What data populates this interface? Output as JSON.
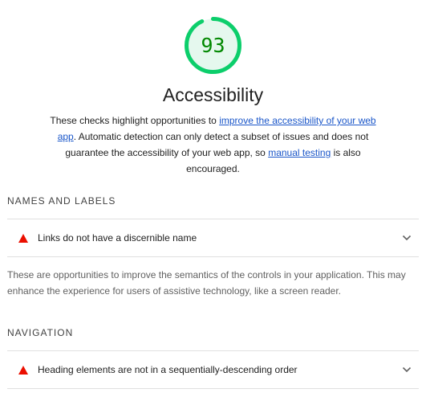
{
  "score": {
    "value": "93",
    "fraction": 0.93,
    "color": "#0cce6b",
    "track_color": "#e5f8ee",
    "text_color": "#008800"
  },
  "category": {
    "title": "Accessibility",
    "description": {
      "part1": "These checks highlight opportunities to ",
      "link1": "improve the accessibility of your web app",
      "part2": ". Automatic detection can only detect a subset of issues and does not guarantee the accessibility of your web app, so ",
      "link2": "manual testing",
      "part3": " is also encouraged."
    }
  },
  "groups": [
    {
      "title": "NAMES AND LABELS",
      "audits": [
        {
          "label": "Links do not have a discernible name",
          "icon": "fail-triangle-icon"
        }
      ],
      "description": "These are opportunities to improve the semantics of the controls in your application. This may enhance the experience for users of assistive technology, like a screen reader."
    },
    {
      "title": "NAVIGATION",
      "audits": [
        {
          "label": "Heading elements are not in a sequentially-descending order",
          "icon": "fail-triangle-icon"
        }
      ]
    }
  ],
  "colors": {
    "fail": "#eb0f00",
    "link": "#1a56c9",
    "divider": "#e0e0e0"
  }
}
